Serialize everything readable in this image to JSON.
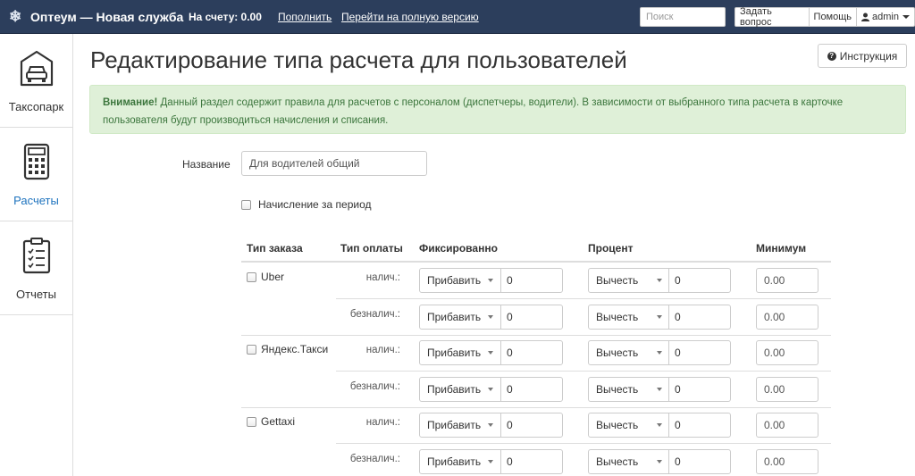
{
  "navbar": {
    "brand": "Оптеум — Новая служба",
    "balance": "На счету: 0.00",
    "topup": "Пополнить",
    "full_version": "Перейти на полную версию",
    "search_placeholder": "Поиск",
    "ask_question": "Задать вопрос",
    "help": "Помощь",
    "user": "admin"
  },
  "sidebar": {
    "items": [
      {
        "label": "Таксопарк",
        "icon": "car-icon",
        "active": false
      },
      {
        "label": "Расчеты",
        "icon": "calculator-icon",
        "active": true
      },
      {
        "label": "Отчеты",
        "icon": "clipboard-icon",
        "active": false
      }
    ]
  },
  "page": {
    "title": "Редактирование типа расчета для пользователей",
    "instruction_button": "Инструкция"
  },
  "alert": {
    "strong": "Внимание!",
    "text": " Данный раздел содержит правила для расчетов с персоналом (диспетчеры, водители). В зависимости от выбранного типа расчета в карточке пользователя будут производиться начисления и списания."
  },
  "form": {
    "name_label": "Название",
    "name_value": "Для водителей общий",
    "period_label": "Начисление за период"
  },
  "table": {
    "headers": {
      "order_type": "Тип заказа",
      "payment_type": "Тип оплаты",
      "fixed": "Фиксированно",
      "percent": "Процент",
      "minimum": "Минимум"
    },
    "pay_labels": [
      "налич.:",
      "безналич.:"
    ],
    "rows": [
      {
        "order": "Uber",
        "cash": {
          "fixed_op": "Прибавить",
          "fixed": "0",
          "percent_op": "Вычесть",
          "percent": "0",
          "min": "0.00"
        },
        "cashless": {
          "fixed_op": "Прибавить",
          "fixed": "0",
          "percent_op": "Вычесть",
          "percent": "0",
          "min": "0.00"
        }
      },
      {
        "order": "Яндекс.Такси",
        "cash": {
          "fixed_op": "Прибавить",
          "fixed": "0",
          "percent_op": "Вычесть",
          "percent": "0",
          "min": "0.00"
        },
        "cashless": {
          "fixed_op": "Прибавить",
          "fixed": "0",
          "percent_op": "Вычесть",
          "percent": "0",
          "min": "0.00"
        }
      },
      {
        "order": "Gettaxi",
        "cash": {
          "fixed_op": "Прибавить",
          "fixed": "0",
          "percent_op": "Вычесть",
          "percent": "0",
          "min": "0.00"
        },
        "cashless": {
          "fixed_op": "Прибавить",
          "fixed": "0",
          "percent_op": "Вычесть",
          "percent": "0",
          "min": "0.00"
        }
      }
    ]
  },
  "colors": {
    "navbar": "#2c3e5c",
    "accent": "#1e73be",
    "alert_bg": "#dff0d8",
    "alert_text": "#3c763d"
  }
}
